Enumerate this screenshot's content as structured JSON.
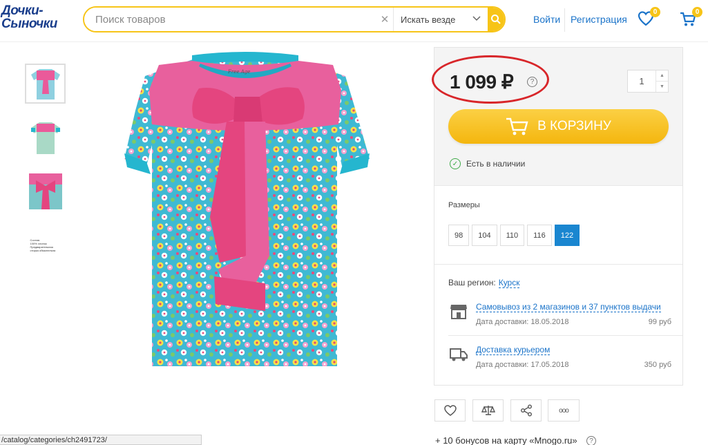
{
  "logo": {
    "line1": "Дочки-",
    "line2": "Сыночки"
  },
  "search": {
    "placeholder": "Поиск товаров",
    "scope": "Искать везде"
  },
  "header": {
    "login": "Войти",
    "register": "Регистрация",
    "favorites_count": "0",
    "cart_count": "0"
  },
  "product": {
    "thumbnail_text": "Состав:\n100% хлопок\nПредварительная стирка обязательна",
    "price": "1 099 ₽",
    "price_help": "?",
    "quantity": "1",
    "add_to_cart": "В КОРЗИНУ",
    "stock": "Есть в наличии",
    "sizes_label": "Размеры",
    "sizes": [
      "98",
      "104",
      "110",
      "116",
      "122"
    ],
    "selected_size": "122"
  },
  "delivery": {
    "region_label": "Ваш регион:",
    "region": "Курск",
    "pickup_title": "Самовывоз из 2 магазинов и 37 пунктов выдачи",
    "pickup_date": "Дата доставки: 18.05.2018",
    "pickup_price": "99 руб",
    "courier_title": "Доставка курьером",
    "courier_date": "Дата доставки: 17.05.2018",
    "courier_price": "350 руб"
  },
  "actions": {
    "more": "ooo"
  },
  "bonus": {
    "text": "+ 10 бонусов на карту «Mnogo.ru»",
    "help": "?"
  },
  "statusbar": "/catalog/categories/ch2491723/",
  "colors": {
    "accent": "#f7c417",
    "link": "#1a73c9",
    "selected": "#1a86d0",
    "success": "#3faa48",
    "highlight": "#d8262a"
  }
}
